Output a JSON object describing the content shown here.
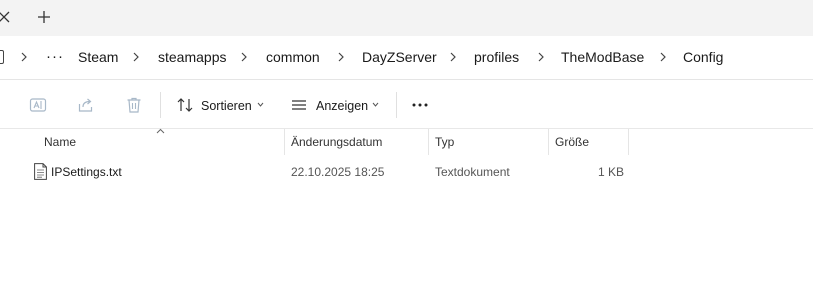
{
  "tabstrip": {
    "close_icon": "close-icon",
    "new_tab_icon": "plus-icon"
  },
  "addressbar": {
    "overflow": "···",
    "crumbs": [
      "Steam",
      "steamapps",
      "common",
      "DayZServer",
      "profiles",
      "TheModBase",
      "Config"
    ]
  },
  "commandbar": {
    "rename_icon": "rename-icon",
    "share_icon": "share-icon",
    "delete_icon": "trash-icon",
    "sort_label": "Sortieren",
    "view_label": "Anzeigen",
    "more_label": "···"
  },
  "list": {
    "columns": {
      "name": "Name",
      "date": "Änderungsdatum",
      "type": "Typ",
      "size": "Größe"
    },
    "rows": [
      {
        "name": "IPSettings.txt",
        "date": "22.10.2025 18:25",
        "type": "Textdokument",
        "size": "1 KB"
      }
    ]
  },
  "colors": {
    "tabstrip_bg": "#f3f3f3",
    "disabled_icon": "#a8b8c8",
    "text": "#1a1a1a"
  }
}
